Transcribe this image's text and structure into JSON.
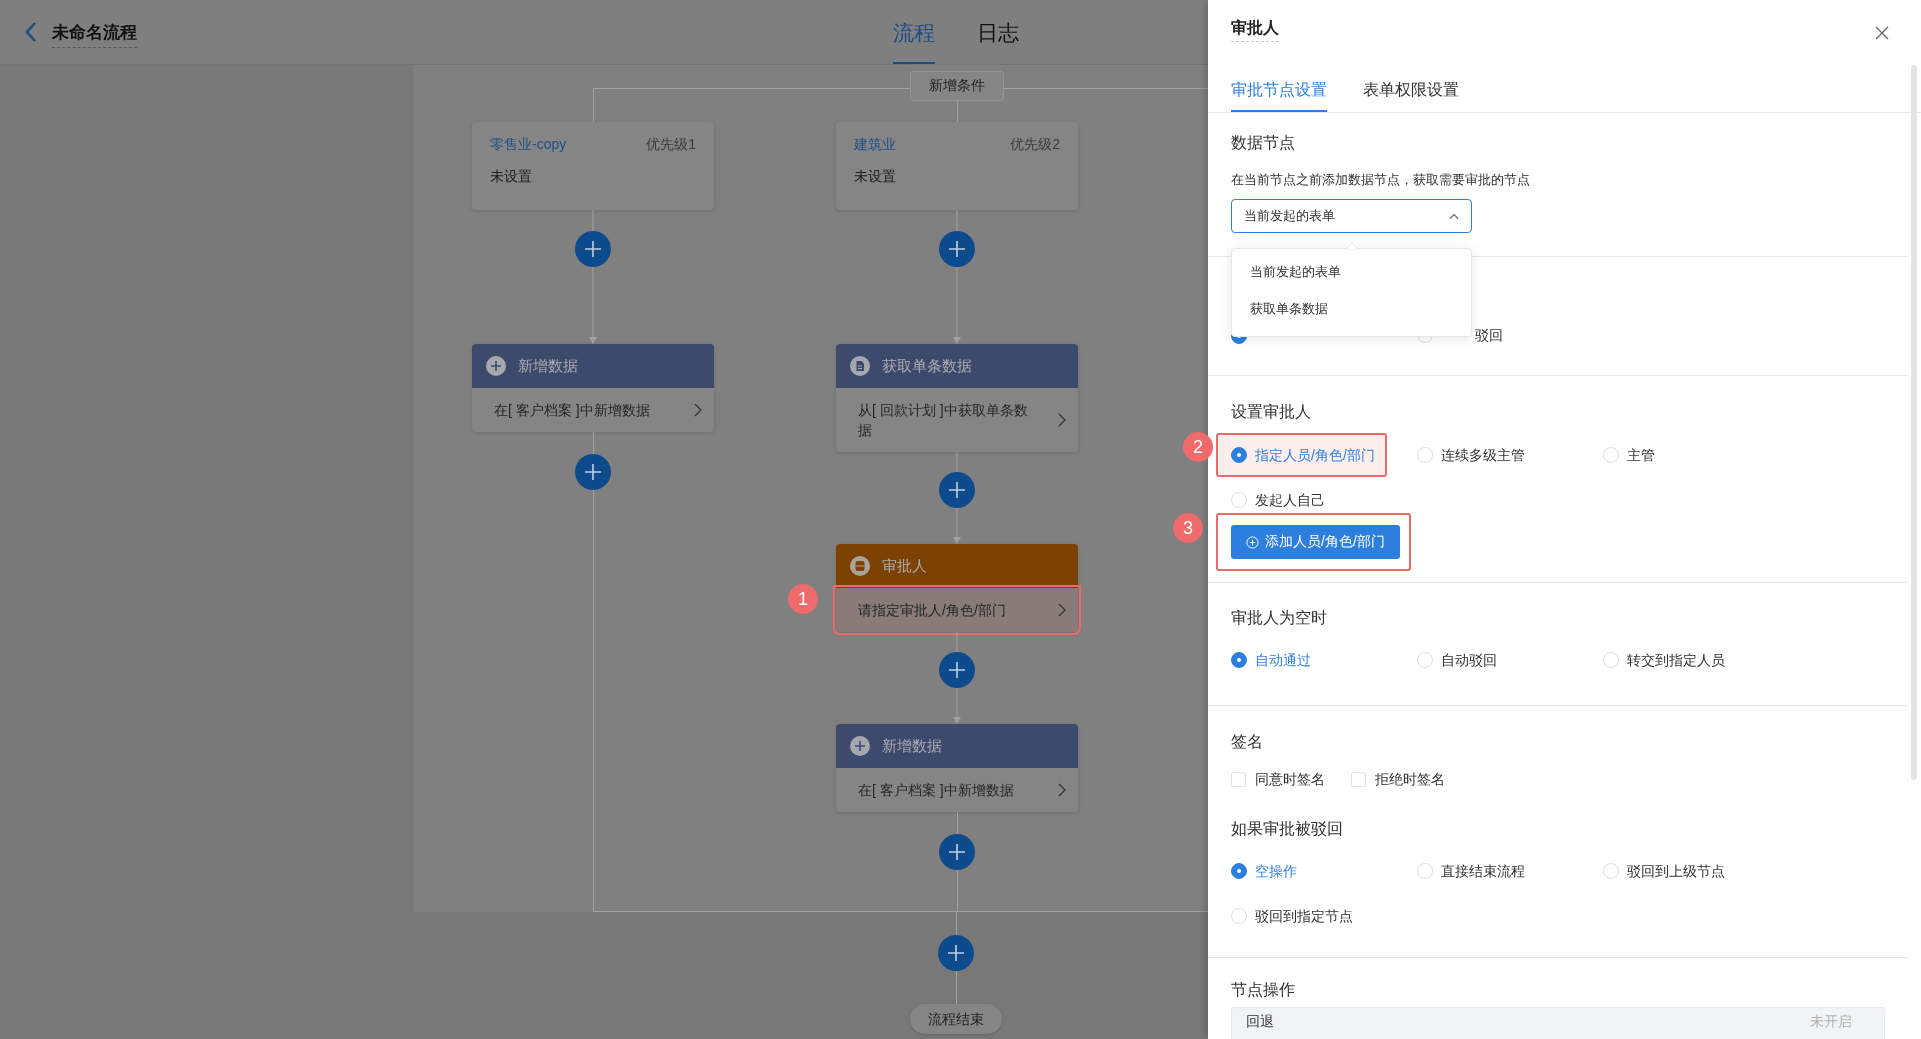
{
  "header": {
    "title": "未命名流程",
    "tabs": [
      {
        "label": "流程",
        "selected": true
      },
      {
        "label": "日志",
        "selected": false
      }
    ]
  },
  "canvas": {
    "add_condition": "新增条件",
    "branches": [
      {
        "name": "零售业-copy",
        "priority": "优先级1",
        "summary": "未设置",
        "nodes": [
          {
            "kind": "add_data",
            "title": "新增数据",
            "detail": "在[ 客户档案 ]中新增数据",
            "highlighted": false
          }
        ]
      },
      {
        "name": "建筑业",
        "priority": "优先级2",
        "summary": "未设置",
        "nodes": [
          {
            "kind": "get_data",
            "title": "获取单条数据",
            "detail": "从[ 回款计划 ]中获取单条数据",
            "highlighted": false
          },
          {
            "kind": "approver",
            "title": "审批人",
            "detail": "请指定审批人/角色/部门",
            "highlighted": true,
            "badge": "1"
          },
          {
            "kind": "add_data",
            "title": "新增数据",
            "detail": "在[ 客户档案 ]中新增数据",
            "highlighted": false
          }
        ]
      }
    ],
    "end": "流程结束"
  },
  "panel": {
    "title": "审批人",
    "tabs": [
      {
        "label": "审批节点设置",
        "selected": true
      },
      {
        "label": "表单权限设置",
        "selected": false
      }
    ],
    "data_node": {
      "heading": "数据节点",
      "description": "在当前节点之前添加数据节点，获取需要审批的节点",
      "select": {
        "value": "当前发起的表单",
        "expanded": true
      },
      "menu": [
        "当前发起的表单",
        "获取单条数据"
      ]
    },
    "pass_mode": {
      "options": [
        {
          "selected": true
        },
        {
          "label": "驳回",
          "selected": false
        }
      ]
    },
    "approver": {
      "heading": "设置审批人",
      "options": [
        {
          "label": "指定人员/角色/部门",
          "selected": true,
          "badge": "2"
        },
        {
          "label": "连续多级主管",
          "selected": false
        },
        {
          "label": "主管",
          "selected": false
        },
        {
          "label": "发起人自己",
          "selected": false
        }
      ],
      "add_button": {
        "label": "添加人员/角色/部门",
        "badge": "3"
      }
    },
    "empty_approver": {
      "heading": "审批人为空时",
      "options": [
        {
          "label": "自动通过",
          "selected": true
        },
        {
          "label": "自动驳回",
          "selected": false
        },
        {
          "label": "转交到指定人员",
          "selected": false
        }
      ]
    },
    "signature": {
      "heading": "签名",
      "options": [
        {
          "label": "同意时签名",
          "checked": false
        },
        {
          "label": "拒绝时签名",
          "checked": false
        }
      ]
    },
    "rejected": {
      "heading": "如果审批被驳回",
      "options": [
        {
          "label": "空操作",
          "selected": true
        },
        {
          "label": "直接结束流程",
          "selected": false
        },
        {
          "label": "驳回到上级节点",
          "selected": false
        },
        {
          "label": "驳回到指定节点",
          "selected": false
        }
      ]
    },
    "node_actions": {
      "heading": "节点操作",
      "rows": [
        {
          "label": "回退",
          "status": "未开启"
        }
      ]
    }
  }
}
